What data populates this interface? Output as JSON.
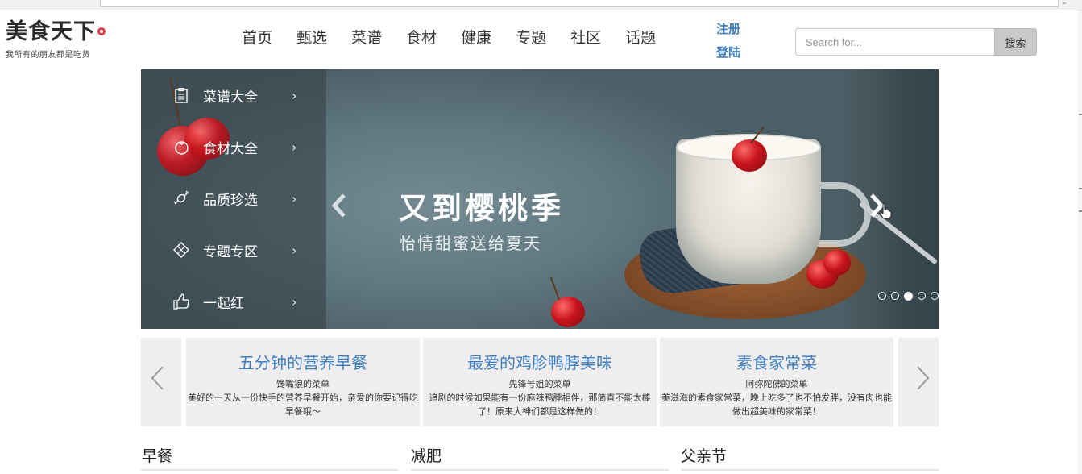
{
  "header": {
    "logo_title": "美食天下",
    "logo_subtitle": "我所有的朋友都是吃货",
    "nav": [
      "首页",
      "甄选",
      "菜谱",
      "食材",
      "健康",
      "专题",
      "社区",
      "话题"
    ],
    "register": "注册",
    "login": "登陆",
    "search_placeholder": "Search for...",
    "search_button": "搜索"
  },
  "banner": {
    "menu": [
      {
        "label": "菜谱大全",
        "icon": "clipboard-icon"
      },
      {
        "label": "食材大全",
        "icon": "tomato-icon"
      },
      {
        "label": "品质珍选",
        "icon": "candy-icon"
      },
      {
        "label": "专题专区",
        "icon": "diamond-grid-icon"
      },
      {
        "label": "一起红",
        "icon": "thumbs-up-icon"
      }
    ],
    "headline": "又到樱桃季",
    "subline": "怡情甜蜜送给夏天",
    "slide_count": 5,
    "active_slide": 3
  },
  "carousel": [
    {
      "title": "五分钟的营养早餐",
      "author": "馋嘴狼的菜单",
      "desc": "美好的一天从一份快手的营养早餐开始，亲爱的你要记得吃早餐哦～"
    },
    {
      "title": "最爱的鸡胗鸭脖美味",
      "author": "先锋号姐的菜单",
      "desc": "追剧的时候如果能有一份麻辣鸭脖相伴，那简直不能太棒了！原来大神们都是这样做的！"
    },
    {
      "title": "素食家常菜",
      "author": "阿弥陀佛的菜单",
      "desc": "美滋滋的素食家常菜，晚上吃多了也不怕发胖，没有肉也能做出超美味的家常菜！"
    }
  ],
  "categories": [
    "早餐",
    "减肥",
    "父亲节"
  ],
  "colors": {
    "link": "#3f7fc0",
    "banner_bg": "#607880",
    "card_bg": "#efeded"
  }
}
